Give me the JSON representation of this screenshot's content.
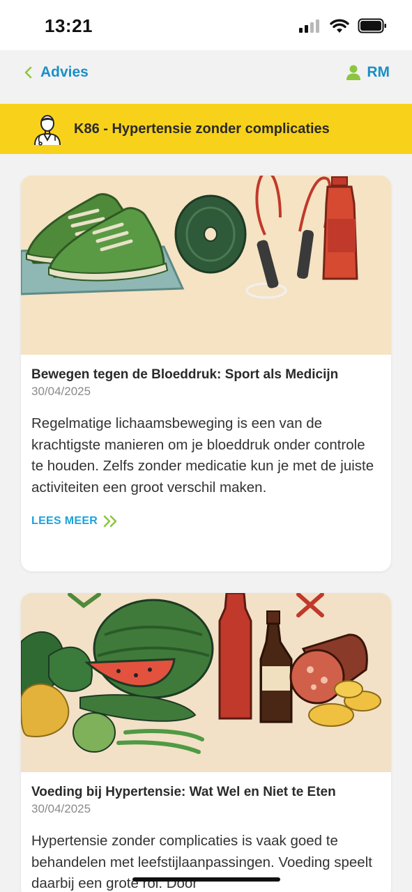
{
  "status_bar": {
    "time": "13:21",
    "icons": [
      "cellular-signal-icon",
      "wifi-icon",
      "battery-icon"
    ]
  },
  "nav": {
    "back_label": "Advies",
    "user_initials": "RM"
  },
  "banner": {
    "title": "K86 - Hypertensie zonder complicaties",
    "icon": "doctor-icon"
  },
  "articles": [
    {
      "title": "Bewegen tegen de Bloeddruk: Sport als Medicijn",
      "date": "30/04/2025",
      "description": "Regelmatige lichaamsbeweging is een van de krachtigste manieren om je bloeddruk onder controle te houden. Zelfs zonder medicatie kun je met de juiste activiteiten een groot verschil maken.",
      "link_label": "LEES MEER"
    },
    {
      "title": "Voeding bij Hypertensie: Wat Wel en Niet te Eten",
      "date": "30/04/2025",
      "description": "Hypertensie zonder complicaties is vaak goed te behandelen met leefstijlaanpassingen. Voeding speelt daarbij een grote rol. Door"
    }
  ],
  "colors": {
    "accent_blue": "#1a8fc7",
    "banner_yellow": "#f8d21a",
    "link_blue": "#1aa3dd",
    "chevron_green": "#8cc63f"
  }
}
